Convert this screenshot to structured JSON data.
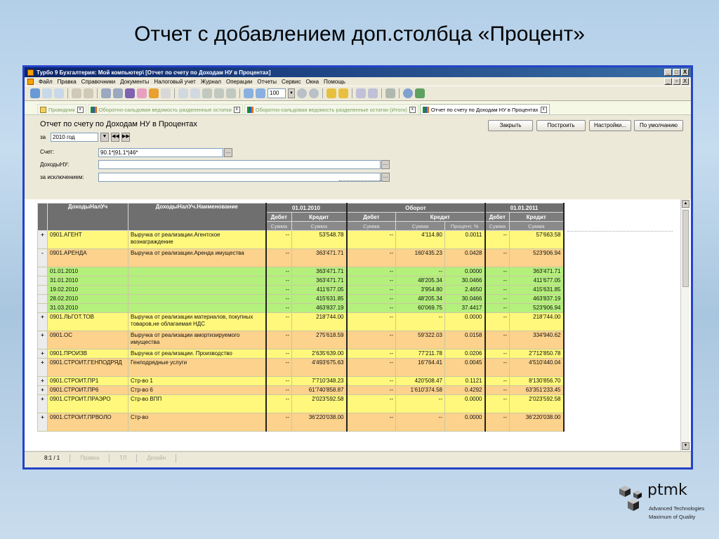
{
  "slide_title": "Отчет с добавлением доп.столбца «Процент»",
  "window": {
    "title": "Турбо 9 Бухгалтерия: Мой компьютер\\        [Отчет по счету по Доходам НУ в Процентах]",
    "controls": [
      "_",
      "□",
      "X"
    ],
    "menu_controls": [
      "_",
      "▫",
      "X"
    ]
  },
  "menu": [
    "Файл",
    "Правка",
    "Справочники",
    "Документы",
    "Налоговый учет",
    "Журнал",
    "Операции",
    "Отчеты",
    "Сервис",
    "Окна",
    "Помощь"
  ],
  "toolbar": {
    "zoom_value": "100"
  },
  "tabs": [
    {
      "label": "Проводник",
      "active": false
    },
    {
      "label": "Оборотно-сальдовая ведомость разделенные остатки",
      "active": false
    },
    {
      "label": "Оборотно-сальдовая ведомость разделенные остатки (Итоги)",
      "active": false
    },
    {
      "label": "Отчет по счету по Доходам НУ в Процентах",
      "active": true
    }
  ],
  "report": {
    "title": "Отчет по счету по Доходам НУ в Процентах",
    "period_label": "за",
    "period_value": "2010 год",
    "account_label": "Счет:",
    "account_value": "90.1*|91.1*|46*",
    "income_label": "ДоходыНУ:",
    "income_value": "",
    "except_label": "за исключением:",
    "except_value": ""
  },
  "buttons": {
    "close": "Закрыть",
    "build": "Построить",
    "settings": "Настройки...",
    "default": "По умолчанию"
  },
  "table": {
    "headers": {
      "code": "ДоходыНалУч",
      "name": "ДоходыНалУч.Наименование",
      "date_start": "01.01.2010",
      "turnover": "Оборот",
      "date_end": "01.01.2011",
      "debit": "Дебет",
      "credit": "Кредит",
      "sum": "Сумма",
      "percent": "Процент, %"
    },
    "rows": [
      {
        "lvl": 1,
        "alt": false,
        "tall": true,
        "pm": "+",
        "code": "0901.АГЕНТ",
        "name": "Выручка от реализации.Агентское вознаграждение",
        "d1": "--",
        "c1": "53'548.78",
        "d2": "--",
        "c2": "4'114.80",
        "pct": "0.0011",
        "d3": "--",
        "c3": "57'663.58"
      },
      {
        "lvl": 1,
        "alt": true,
        "tall": true,
        "pm": "-",
        "code": "0901.АРЕНДА",
        "name": "Выручка от реализации.Аренда имущества",
        "d1": "--",
        "c1": "363'471.71",
        "d2": "--",
        "c2": "160'435.23",
        "pct": "0.0428",
        "d3": "--",
        "c3": "523'906.94"
      },
      {
        "lvl": 2,
        "alt": false,
        "tall": false,
        "pm": "",
        "code": "01.01.2010",
        "name": "",
        "d1": "--",
        "c1": "363'471.71",
        "d2": "--",
        "c2": "--",
        "pct": "0.0000",
        "d3": "--",
        "c3": "363'471.71"
      },
      {
        "lvl": 2,
        "alt": false,
        "tall": false,
        "pm": "",
        "code": "31.01.2010",
        "name": "",
        "d1": "--",
        "c1": "363'471.71",
        "d2": "--",
        "c2": "48'205.34",
        "pct": "30.0466",
        "d3": "--",
        "c3": "411'677.05"
      },
      {
        "lvl": 2,
        "alt": false,
        "tall": false,
        "pm": "",
        "code": "19.02.2010",
        "name": "",
        "d1": "--",
        "c1": "411'677.05",
        "d2": "--",
        "c2": "3'954.80",
        "pct": "2.4650",
        "d3": "--",
        "c3": "415'631.85"
      },
      {
        "lvl": 2,
        "alt": false,
        "tall": false,
        "pm": "",
        "code": "28.02.2010",
        "name": "",
        "d1": "--",
        "c1": "415'631.85",
        "d2": "--",
        "c2": "48'205.34",
        "pct": "30.0466",
        "d3": "--",
        "c3": "463'837.19"
      },
      {
        "lvl": 2,
        "alt": false,
        "tall": false,
        "pm": "",
        "code": "31.03.2010",
        "name": "",
        "d1": "--",
        "c1": "463'837.19",
        "d2": "--",
        "c2": "60'069.75",
        "pct": "37.4417",
        "d3": "--",
        "c3": "523'906.94"
      },
      {
        "lvl": 1,
        "alt": false,
        "tall": true,
        "pm": "+",
        "code": "0901.ЛЬГОТ.ТОВ",
        "name": "Выручка от реализации материалов, покупных товаров,не облагаемая НДС",
        "d1": "--",
        "c1": "218'744.00",
        "d2": "--",
        "c2": "--",
        "pct": "0.0000",
        "d3": "--",
        "c3": "218'744.00"
      },
      {
        "lvl": 1,
        "alt": true,
        "tall": true,
        "pm": "+",
        "code": "0901.ОС",
        "name": "Выручка от реализации амортизируемого имущества",
        "d1": "--",
        "c1": "275'618.59",
        "d2": "--",
        "c2": "59'322.03",
        "pct": "0.0158",
        "d3": "--",
        "c3": "334'940.62"
      },
      {
        "lvl": 1,
        "alt": false,
        "tall": false,
        "pm": "+",
        "code": "0901.ПРОИЗВ",
        "name": "Выручка от реализации. Производство",
        "d1": "--",
        "c1": "2'635'639.00",
        "d2": "--",
        "c2": "77'211.78",
        "pct": "0.0206",
        "d3": "--",
        "c3": "2'712'850.78"
      },
      {
        "lvl": 1,
        "alt": true,
        "tall": true,
        "pm": "+",
        "code": "0901.СТРОИТ.ГЕНПОДРЯД",
        "name": "Генподрядные услуги",
        "d1": "--",
        "c1": "4'493'675.63",
        "d2": "--",
        "c2": "16'764.41",
        "pct": "0.0045",
        "d3": "--",
        "c3": "4'510'440.04"
      },
      {
        "lvl": 1,
        "alt": false,
        "tall": false,
        "pm": "+",
        "code": "0901.СТРОИТ.ПР1",
        "name": "Стр-во 1",
        "d1": "--",
        "c1": "7'710'348.23",
        "d2": "--",
        "c2": "420'508.47",
        "pct": "0.1121",
        "d3": "--",
        "c3": "8'130'856.70"
      },
      {
        "lvl": 1,
        "alt": true,
        "tall": false,
        "pm": "+",
        "code": "0901.СТРОИТ.ПР6",
        "name": "Стр-во 6",
        "d1": "--",
        "c1": "61'740'858.87",
        "d2": "--",
        "c2": "1'610'374.58",
        "pct": "0.4292",
        "d3": "--",
        "c3": "63'351'233.45"
      },
      {
        "lvl": 1,
        "alt": false,
        "tall": true,
        "pm": "+",
        "code": "0901.СТРОИТ.ПРАЭРО",
        "name": "Стр-во ВПП",
        "d1": "--",
        "c1": "2'023'592.58",
        "d2": "--",
        "c2": "--",
        "pct": "0.0000",
        "d3": "--",
        "c3": "2'023'592.58"
      },
      {
        "lvl": 1,
        "alt": true,
        "tall": true,
        "pm": "+",
        "code": "0901.СТРОИТ.ПРВОЛО",
        "name": "Стр-во",
        "d1": "--",
        "c1": "36'220'038.00",
        "d2": "--",
        "c2": "--",
        "pct": "0.0000",
        "d3": "--",
        "c3": "36'220'038.00"
      }
    ]
  },
  "status": {
    "position": "8:1 / 1",
    "edit": "Правка",
    "mode": "ТЛ",
    "design": "Дизайн"
  },
  "logo": {
    "name": "ptmk",
    "tagline1": "Advanced Technologies",
    "tagline2": "Maximum of Quality"
  },
  "colors": {
    "level1": "#fff87c",
    "level1_alt": "#fcd28c",
    "level2": "#b4f07c",
    "header": "#7d7d7d",
    "frame": "#2543c9"
  }
}
